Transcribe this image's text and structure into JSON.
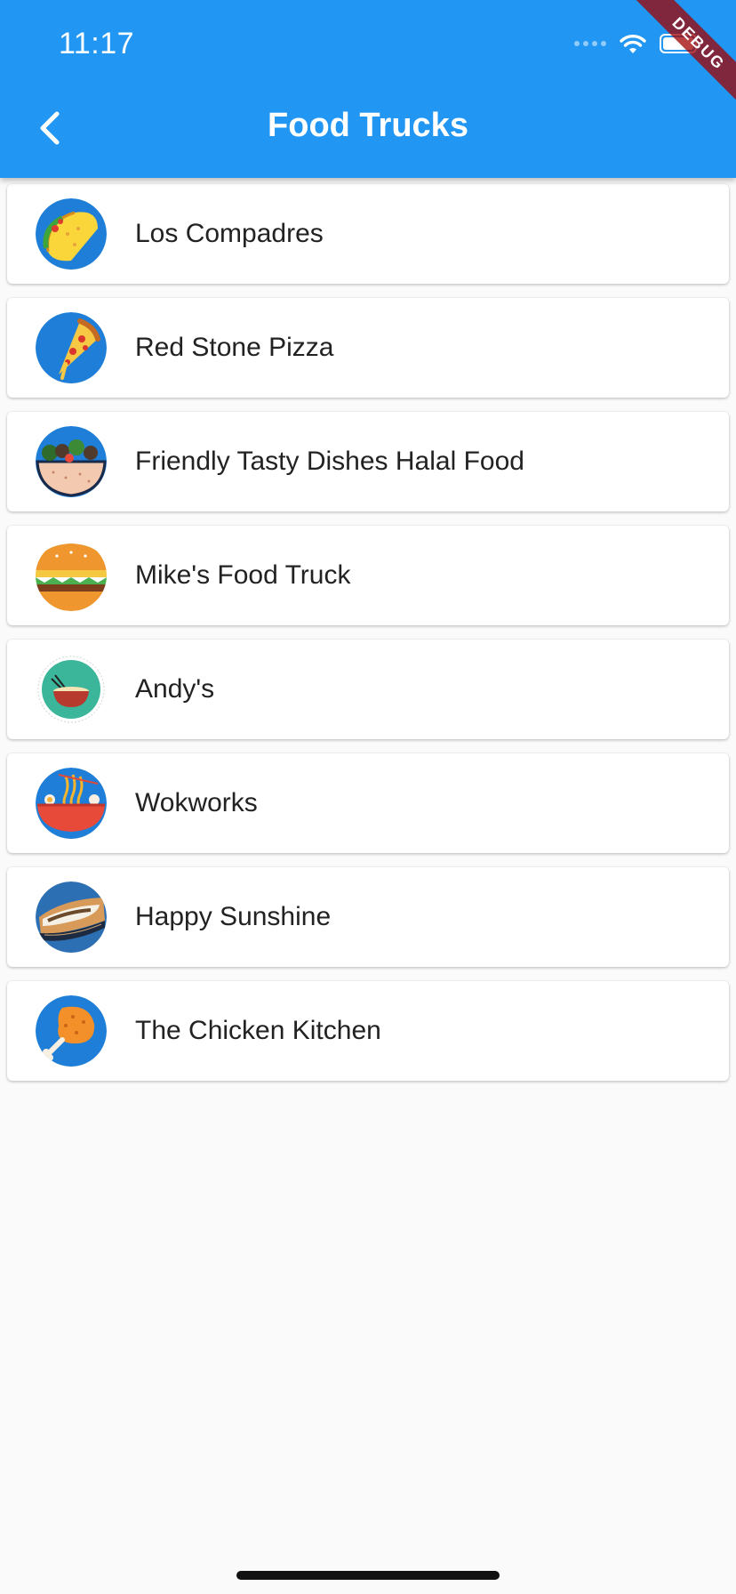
{
  "status": {
    "time": "11:17"
  },
  "appbar": {
    "title": "Food Trucks",
    "color": "#2196f3"
  },
  "debug_banner": "DEBUG",
  "trucks": [
    {
      "name": "Los Compadres",
      "icon": "taco-icon"
    },
    {
      "name": "Red Stone Pizza",
      "icon": "pizza-slice-icon"
    },
    {
      "name": "Friendly Tasty Dishes Halal Food",
      "icon": "halal-bowl-icon"
    },
    {
      "name": "Mike's Food Truck",
      "icon": "burger-icon"
    },
    {
      "name": "Andy's",
      "icon": "noodle-bowl-icon"
    },
    {
      "name": "Wokworks",
      "icon": "ramen-bowl-icon"
    },
    {
      "name": "Happy Sunshine",
      "icon": "cheesesteak-sandwich-icon"
    },
    {
      "name": "The Chicken Kitchen",
      "icon": "fried-chicken-icon"
    }
  ]
}
